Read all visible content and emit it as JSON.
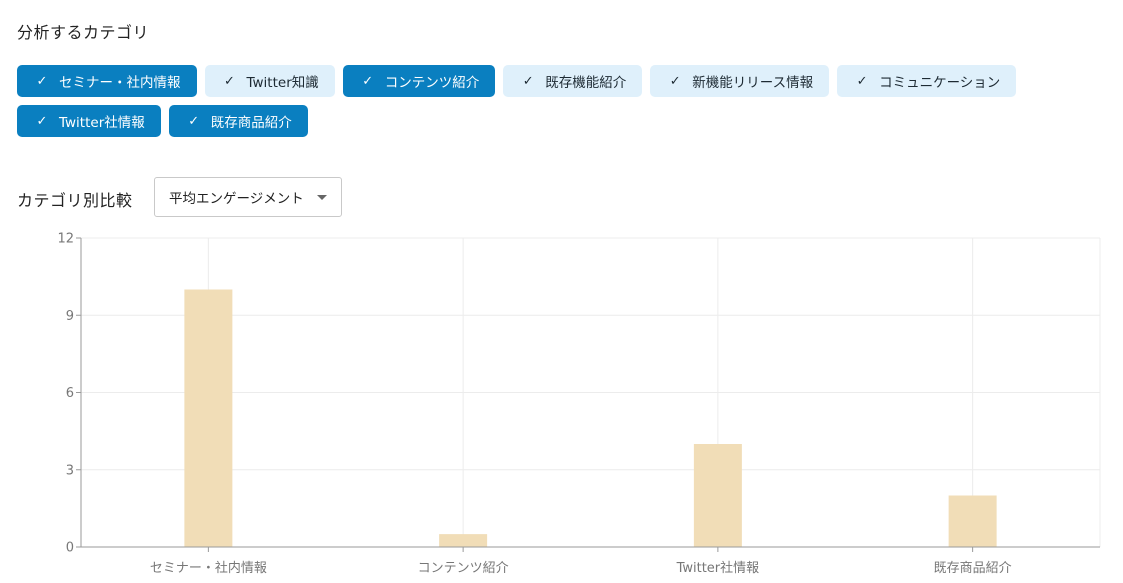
{
  "section_title": "分析するカテゴリ",
  "categories_filter": [
    {
      "label": "セミナー・社内情報",
      "selected": true
    },
    {
      "label": "Twitter知識",
      "selected": false
    },
    {
      "label": "コンテンツ紹介",
      "selected": true
    },
    {
      "label": "既存機能紹介",
      "selected": false
    },
    {
      "label": "新機能リリース情報",
      "selected": false
    },
    {
      "label": "コミュニケーション",
      "selected": false
    },
    {
      "label": "Twitter社情報",
      "selected": true
    },
    {
      "label": "既存商品紹介",
      "selected": true
    }
  ],
  "check_glyph": "✓",
  "comparison": {
    "label": "カテゴリ別比較",
    "metric_selected": "平均エンゲージメント"
  },
  "colors": {
    "selected_chip": "#0a7fc0",
    "unselected_chip": "#dff0fb",
    "bar": "#f1ddb7"
  },
  "chart_data": {
    "type": "bar",
    "categories": [
      "セミナー・社内情報",
      "コンテンツ紹介",
      "Twitter社情報",
      "既存商品紹介"
    ],
    "values": [
      10,
      0.5,
      4,
      2
    ],
    "yticks": [
      0,
      3,
      6,
      9,
      12
    ],
    "ylim": [
      0,
      12
    ],
    "grid": true,
    "legend": "none",
    "title": "",
    "xlabel": "",
    "ylabel": ""
  }
}
